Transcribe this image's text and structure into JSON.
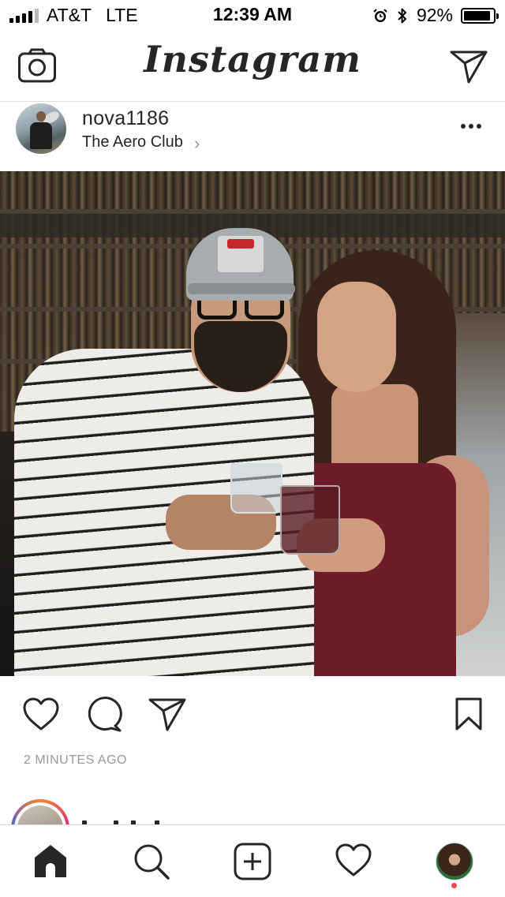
{
  "status_bar": {
    "carrier": "AT&T",
    "network": "LTE",
    "time": "12:39 AM",
    "battery_percent": "92%",
    "battery_level": 0.92,
    "icons": [
      "signal-icon",
      "alarm-icon",
      "bluetooth-icon",
      "battery-icon"
    ]
  },
  "header": {
    "logo_text": "Instagram",
    "left_icon": "camera-icon",
    "right_icon": "direct-message-icon"
  },
  "post": {
    "username": "nova1186",
    "location": "The Aero Club",
    "location_chevron": "›",
    "more_icon": "more-options-icon",
    "timestamp": "2 MINUTES AGO",
    "actions": [
      "like-icon",
      "comment-icon",
      "share-icon",
      "save-icon"
    ]
  },
  "tab_bar": {
    "tabs": [
      "home-icon",
      "search-icon",
      "new-post-icon",
      "activity-icon",
      "profile-avatar"
    ],
    "active": "home",
    "accent_color": "#ed4956"
  },
  "colors": {
    "text": "#262626",
    "muted": "#999999",
    "divider": "#dbdbdb"
  }
}
